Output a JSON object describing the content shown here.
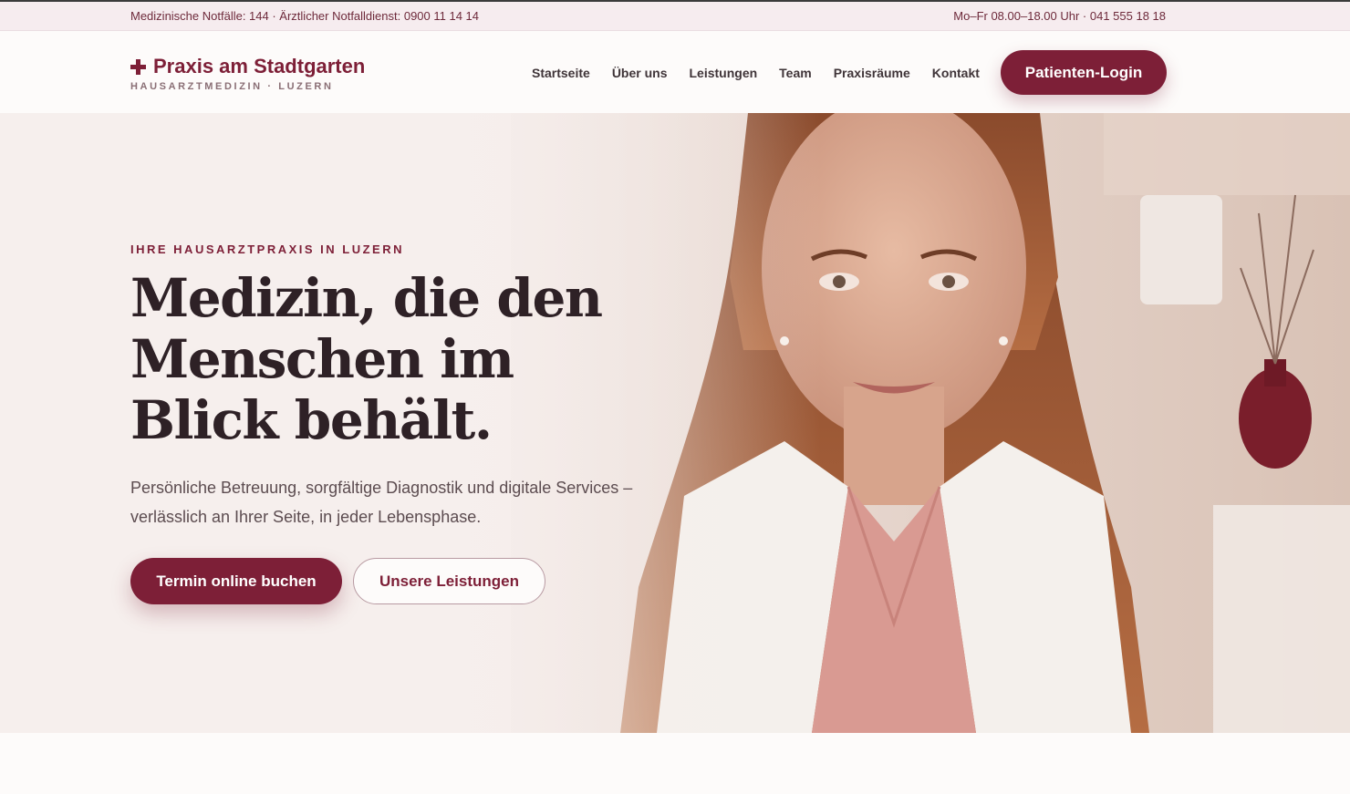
{
  "topbar": {
    "emergency": "Medizinische Notfälle: 144 · Ärztlicher Notfalldienst: 0900 11 14 14",
    "hours": "Mo–Fr 08.00–18.00 Uhr · 041 555 18 18"
  },
  "header": {
    "logo_icon": "medical-cross-icon",
    "logo_title": "Praxis am Stadtgarten",
    "logo_subtitle": "HAUSARZTMEDIZIN · LUZERN",
    "nav": [
      "Startseite",
      "Über uns",
      "Leistungen",
      "Team",
      "Praxisräume",
      "Kontakt"
    ],
    "login_label": "Patienten-Login"
  },
  "hero": {
    "eyebrow": "IHRE HAUSARZTPRAXIS IN LUZERN",
    "headline": "Medizin, die den Menschen im Blick behält.",
    "lead": "Persönliche Betreuung, sorgfältige Diagnostik und digitale Services – verlässlich an Ihrer Seite, in jeder Lebensphase.",
    "primary_cta": "Termin online buchen",
    "secondary_cta": "Unsere Leistungen"
  },
  "colors": {
    "brand": "#7d1f37",
    "topbar_bg": "#f6ecef",
    "text_dark": "#2e2126"
  }
}
